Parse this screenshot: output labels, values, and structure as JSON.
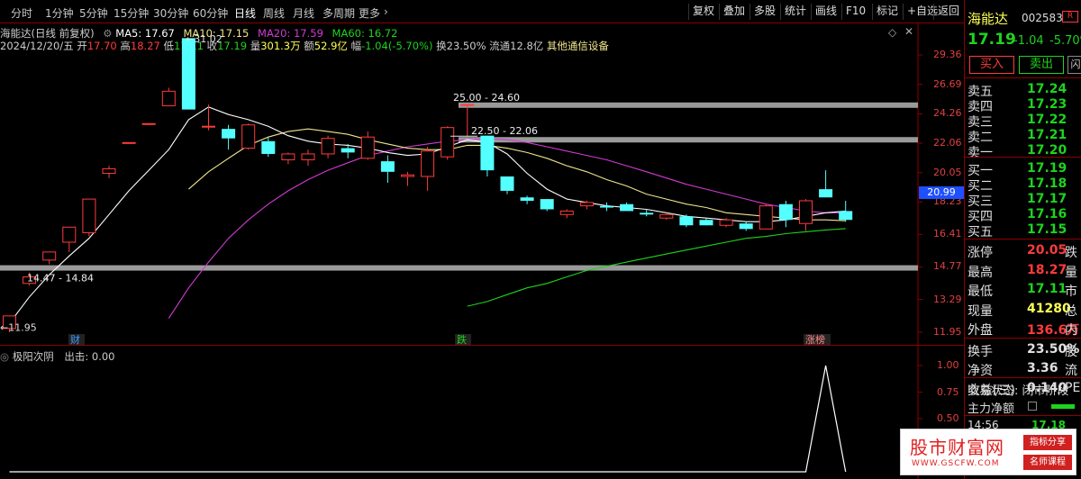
{
  "toolbar": {
    "periods": [
      "分时",
      "1分钟",
      "5分钟",
      "15分钟",
      "30分钟",
      "60分钟",
      "日线",
      "周线",
      "月线",
      "多周期",
      "更多"
    ],
    "active_period": "日线",
    "more_arrow": "›",
    "right_buttons": [
      "复权",
      "叠加",
      "多股",
      "统计",
      "画线",
      "F10",
      "标记",
      "+自选",
      "返回"
    ]
  },
  "info_line1": {
    "title": "海能达(日线 前复权)",
    "ma5": "MA5: 17.67",
    "ma10": "MA10: 17.15",
    "ma20": "MA20: 17.59",
    "ma60": "MA60: 16.72"
  },
  "info_line2": {
    "date": "2024/12/20/五",
    "open_label": "开",
    "open": "17.70",
    "high_label": "高",
    "high": "18.27",
    "low_label": "低",
    "low": "17.11",
    "close_label": "收",
    "close": "17.19",
    "vol_label": "量",
    "vol": "301.3万",
    "amt_label": "额",
    "amt": "52.9亿",
    "range_label": "幅",
    "range": "-1.04(-5.70%)",
    "turnover_label": "换",
    "turnover": "23.50%",
    "float_label": "流通",
    "float": "12.8亿",
    "sector": "其他通信设备"
  },
  "main_chart": {
    "price_ticks": [
      "29.36",
      "26.69",
      "24.26",
      "22.06",
      "20.05",
      "18.23",
      "16.41",
      "14.77",
      "13.29",
      "11.95"
    ],
    "current_price_tag": "20.99",
    "annotations": {
      "high": "31.02",
      "low": "11.95",
      "zone1": "25.00 - 24.60",
      "zone2": "22.50 - 22.06",
      "zone3": "14.47 - 14.84"
    },
    "markers": {
      "fin": "财",
      "fall": "跌",
      "limit": "涨榜"
    }
  },
  "chart_data": {
    "type": "candlestick",
    "y_scale": "log",
    "ylim": [
      11.95,
      29.36
    ],
    "candles": [
      {
        "o": 12.1,
        "h": 12.6,
        "l": 11.95,
        "c": 12.6
      },
      {
        "o": 14.0,
        "h": 14.5,
        "l": 13.9,
        "c": 14.3
      },
      {
        "o": 15.1,
        "h": 15.5,
        "l": 14.9,
        "c": 15.5
      },
      {
        "o": 16.0,
        "h": 16.8,
        "l": 15.5,
        "c": 16.8
      },
      {
        "o": 16.5,
        "h": 18.4,
        "l": 16.3,
        "c": 18.4
      },
      {
        "o": 20.0,
        "h": 20.5,
        "l": 19.7,
        "c": 20.3
      },
      {
        "o": 22.1,
        "h": 22.1,
        "l": 22.1,
        "c": 22.1
      },
      {
        "o": 23.5,
        "h": 23.5,
        "l": 23.5,
        "c": 23.5
      },
      {
        "o": 24.9,
        "h": 26.4,
        "l": 24.9,
        "c": 26.1
      },
      {
        "o": 31.0,
        "h": 31.0,
        "l": 24.6,
        "c": 24.6
      },
      {
        "o": 23.3,
        "h": 25.0,
        "l": 23.0,
        "c": 23.3
      },
      {
        "o": 23.1,
        "h": 23.4,
        "l": 21.6,
        "c": 22.4
      },
      {
        "o": 21.7,
        "h": 23.5,
        "l": 21.6,
        "c": 23.4
      },
      {
        "o": 22.2,
        "h": 22.5,
        "l": 21.1,
        "c": 21.3
      },
      {
        "o": 20.9,
        "h": 21.4,
        "l": 20.6,
        "c": 21.3
      },
      {
        "o": 20.9,
        "h": 21.6,
        "l": 20.5,
        "c": 21.3
      },
      {
        "o": 21.3,
        "h": 22.6,
        "l": 21.0,
        "c": 22.4
      },
      {
        "o": 21.7,
        "h": 22.0,
        "l": 21.0,
        "c": 21.4
      },
      {
        "o": 21.0,
        "h": 22.9,
        "l": 20.9,
        "c": 22.5
      },
      {
        "o": 20.8,
        "h": 21.2,
        "l": 19.4,
        "c": 20.1
      },
      {
        "o": 19.8,
        "h": 20.1,
        "l": 19.2,
        "c": 19.9
      },
      {
        "o": 19.8,
        "h": 21.8,
        "l": 18.9,
        "c": 21.5
      },
      {
        "o": 21.1,
        "h": 23.3,
        "l": 20.9,
        "c": 23.2
      },
      {
        "o": 25.0,
        "h": 25.0,
        "l": 22.5,
        "c": 25.0
      },
      {
        "o": 22.6,
        "h": 22.6,
        "l": 19.8,
        "c": 20.2
      },
      {
        "o": 19.8,
        "h": 19.8,
        "l": 18.7,
        "c": 18.9
      },
      {
        "o": 18.5,
        "h": 18.6,
        "l": 18.1,
        "c": 18.3
      },
      {
        "o": 18.4,
        "h": 18.4,
        "l": 17.7,
        "c": 17.8
      },
      {
        "o": 17.5,
        "h": 17.8,
        "l": 17.3,
        "c": 17.7
      },
      {
        "o": 18.0,
        "h": 18.3,
        "l": 17.8,
        "c": 18.2
      },
      {
        "o": 18.0,
        "h": 18.2,
        "l": 17.7,
        "c": 17.9
      },
      {
        "o": 18.1,
        "h": 18.2,
        "l": 17.7,
        "c": 17.7
      },
      {
        "o": 17.6,
        "h": 17.8,
        "l": 17.4,
        "c": 17.5
      },
      {
        "o": 17.3,
        "h": 17.6,
        "l": 17.2,
        "c": 17.5
      },
      {
        "o": 17.4,
        "h": 17.5,
        "l": 16.8,
        "c": 16.9
      },
      {
        "o": 17.2,
        "h": 17.3,
        "l": 16.9,
        "c": 16.9
      },
      {
        "o": 16.9,
        "h": 17.3,
        "l": 16.8,
        "c": 17.2
      },
      {
        "o": 17.0,
        "h": 17.1,
        "l": 16.6,
        "c": 16.7
      },
      {
        "o": 16.7,
        "h": 18.1,
        "l": 16.7,
        "c": 18.0
      },
      {
        "o": 18.1,
        "h": 18.3,
        "l": 16.8,
        "c": 17.2
      },
      {
        "o": 17.0,
        "h": 18.4,
        "l": 16.6,
        "c": 18.3
      },
      {
        "o": 19.0,
        "h": 20.2,
        "l": 18.6,
        "c": 18.5
      },
      {
        "o": 17.7,
        "h": 18.3,
        "l": 17.1,
        "c": 17.2
      }
    ],
    "ma5": [
      12.3,
      13.4,
      14.4,
      15.3,
      16.2,
      17.5,
      18.9,
      20.2,
      21.6,
      23.8,
      24.8,
      24.2,
      23.8,
      23.3,
      22.6,
      22.2,
      22.0,
      21.9,
      21.7,
      21.4,
      21.2,
      21.3,
      21.8,
      22.3,
      22.1,
      21.3,
      20.0,
      19.0,
      18.4,
      18.2,
      18.0,
      17.9,
      17.8,
      17.6,
      17.4,
      17.3,
      17.2,
      17.1,
      17.1,
      17.2,
      17.4,
      17.6,
      17.7
    ],
    "ma10": [
      null,
      null,
      null,
      null,
      null,
      null,
      null,
      null,
      null,
      19.0,
      20.1,
      21.0,
      21.9,
      22.5,
      22.9,
      23.1,
      22.9,
      22.7,
      22.3,
      22.0,
      21.7,
      21.6,
      21.6,
      21.9,
      21.9,
      21.7,
      21.4,
      21.0,
      20.5,
      20.1,
      19.6,
      19.2,
      18.7,
      18.4,
      18.1,
      17.9,
      17.6,
      17.5,
      17.4,
      17.3,
      17.2,
      17.2,
      17.15
    ],
    "ma20": [
      null,
      null,
      null,
      null,
      null,
      null,
      null,
      null,
      12.5,
      13.8,
      15.0,
      16.2,
      17.2,
      18.1,
      18.9,
      19.6,
      20.2,
      20.7,
      21.2,
      21.5,
      21.8,
      22.0,
      22.2,
      22.3,
      22.4,
      22.3,
      22.1,
      21.8,
      21.5,
      21.2,
      20.9,
      20.5,
      20.1,
      19.7,
      19.3,
      19.0,
      18.7,
      18.4,
      18.1,
      17.9,
      17.7,
      17.6,
      17.59
    ],
    "ma60": [
      null,
      null,
      null,
      null,
      null,
      null,
      null,
      null,
      null,
      null,
      null,
      null,
      null,
      null,
      null,
      null,
      null,
      null,
      null,
      null,
      null,
      null,
      null,
      13.0,
      13.2,
      13.5,
      13.8,
      14.0,
      14.3,
      14.6,
      14.8,
      15.0,
      15.2,
      15.4,
      15.6,
      15.8,
      16.0,
      16.2,
      16.3,
      16.45,
      16.55,
      16.65,
      16.72
    ],
    "series_names": [
      "MA5",
      "MA10",
      "MA20",
      "MA60"
    ]
  },
  "sub_chart": {
    "title": "极阳次阴",
    "output_label": "出击: 0.00",
    "ticks": [
      "1.00",
      "0.75",
      "0.50"
    ],
    "signal": [
      0,
      0,
      0,
      0,
      0,
      0,
      0,
      0,
      0,
      0,
      0,
      0,
      0,
      0,
      0,
      0,
      0,
      0,
      0,
      0,
      0,
      0,
      0,
      0,
      0,
      0,
      0,
      0,
      0,
      0,
      0,
      0,
      0,
      0,
      0,
      0,
      0,
      0,
      0,
      0,
      0,
      1,
      0
    ]
  },
  "quote": {
    "name": "海能达",
    "code": "002583",
    "level": "R",
    "price": "17.19",
    "change": "-1.04",
    "change_pct": "-5.70%",
    "buy_btn": "买入",
    "sell_btn": "卖出",
    "more_btn": "闪电",
    "asks": [
      [
        "卖五",
        "17.24"
      ],
      [
        "卖四",
        "17.23"
      ],
      [
        "卖三",
        "17.22"
      ],
      [
        "卖二",
        "17.21"
      ],
      [
        "卖一",
        "17.20"
      ]
    ],
    "bids": [
      [
        "买一",
        "17.19"
      ],
      [
        "买二",
        "17.18"
      ],
      [
        "买三",
        "17.17"
      ],
      [
        "买四",
        "17.16"
      ],
      [
        "买五",
        "17.15"
      ]
    ],
    "stats": [
      [
        "涨停",
        "20.05",
        "跌"
      ],
      [
        "最高",
        "18.27",
        "量"
      ],
      [
        "最低",
        "17.11",
        "市"
      ],
      [
        "现量",
        "41280",
        "总"
      ],
      [
        "外盘",
        "136.6万",
        "内"
      ],
      [
        "换手",
        "23.50%",
        "股"
      ],
      [
        "净资",
        "3.36",
        "流"
      ],
      [
        "收益(三)",
        "0.140",
        "PE"
      ]
    ],
    "trade_status": "交易状态: 闭市阶段",
    "main_flow": "主力净额",
    "tick_time": "14:56",
    "tick_price": "17.18"
  },
  "watermark": {
    "title": "股市财富网",
    "url": "WWW.GSCFW.COM",
    "tag1": "指标分享",
    "tag2": "名师课程"
  },
  "colors": {
    "up": "#ff3b3b",
    "down": "#54ffff",
    "ma5": "#ffffff",
    "ma10": "#f0e68c",
    "ma20": "#d23ad2",
    "ma60": "#1ed31e",
    "axis": "#8b0000"
  }
}
